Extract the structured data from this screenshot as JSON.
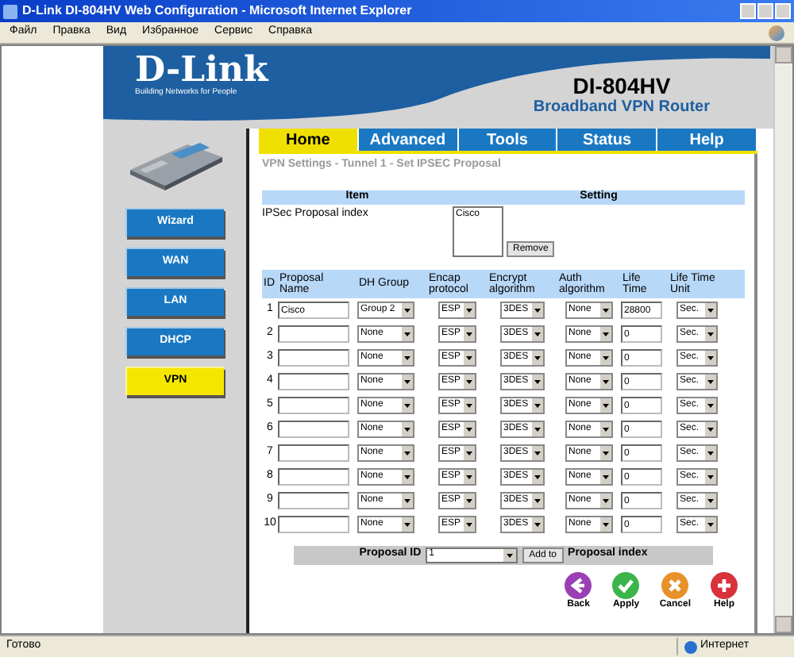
{
  "window": {
    "title": "D-Link DI-804HV Web Configuration - Microsoft Internet Explorer"
  },
  "menu": [
    "Файл",
    "Правка",
    "Вид",
    "Избранное",
    "Сервис",
    "Справка"
  ],
  "header": {
    "logo": "D-Link",
    "tagline": "Building Networks for People",
    "model": "DI-804HV",
    "product": "Broadband VPN Router"
  },
  "tabs": [
    {
      "label": "Home",
      "selected": true
    },
    {
      "label": "Advanced",
      "selected": false
    },
    {
      "label": "Tools",
      "selected": false
    },
    {
      "label": "Status",
      "selected": false
    },
    {
      "label": "Help",
      "selected": false
    }
  ],
  "sidebar": {
    "items": [
      {
        "label": "Wizard",
        "selected": false
      },
      {
        "label": "WAN",
        "selected": false
      },
      {
        "label": "LAN",
        "selected": false
      },
      {
        "label": "DHCP",
        "selected": false
      },
      {
        "label": "VPN",
        "selected": true
      }
    ]
  },
  "section_title": "VPN Settings - Tunnel 1 - Set IPSEC Proposal",
  "index_table": {
    "columns": [
      "Item",
      "Setting"
    ],
    "label": "IPSec Proposal index",
    "entries": [
      "Cisco"
    ],
    "button": "Remove"
  },
  "proposals": {
    "columns": [
      "ID",
      "Proposal Name",
      "DH Group",
      "Encap protocol",
      "Encrypt algorithm",
      "Auth algorithm",
      "Life Time",
      "Life Time Unit"
    ],
    "rows": [
      {
        "id": "1",
        "name": "Cisco",
        "dh": "Group 2",
        "encap": "ESP",
        "encrypt": "3DES",
        "auth": "None",
        "life": "28800",
        "unit": "Sec."
      },
      {
        "id": "2",
        "name": "",
        "dh": "None",
        "encap": "ESP",
        "encrypt": "3DES",
        "auth": "None",
        "life": "0",
        "unit": "Sec."
      },
      {
        "id": "3",
        "name": "",
        "dh": "None",
        "encap": "ESP",
        "encrypt": "3DES",
        "auth": "None",
        "life": "0",
        "unit": "Sec."
      },
      {
        "id": "4",
        "name": "",
        "dh": "None",
        "encap": "ESP",
        "encrypt": "3DES",
        "auth": "None",
        "life": "0",
        "unit": "Sec."
      },
      {
        "id": "5",
        "name": "",
        "dh": "None",
        "encap": "ESP",
        "encrypt": "3DES",
        "auth": "None",
        "life": "0",
        "unit": "Sec."
      },
      {
        "id": "6",
        "name": "",
        "dh": "None",
        "encap": "ESP",
        "encrypt": "3DES",
        "auth": "None",
        "life": "0",
        "unit": "Sec."
      },
      {
        "id": "7",
        "name": "",
        "dh": "None",
        "encap": "ESP",
        "encrypt": "3DES",
        "auth": "None",
        "life": "0",
        "unit": "Sec."
      },
      {
        "id": "8",
        "name": "",
        "dh": "None",
        "encap": "ESP",
        "encrypt": "3DES",
        "auth": "None",
        "life": "0",
        "unit": "Sec."
      },
      {
        "id": "9",
        "name": "",
        "dh": "None",
        "encap": "ESP",
        "encrypt": "3DES",
        "auth": "None",
        "life": "0",
        "unit": "Sec."
      },
      {
        "id": "10",
        "name": "",
        "dh": "None",
        "encap": "ESP",
        "encrypt": "3DES",
        "auth": "None",
        "life": "0",
        "unit": "Sec."
      }
    ]
  },
  "add_bar": {
    "label": "Proposal ID",
    "value": "1",
    "button": "Add to",
    "suffix": "Proposal index"
  },
  "actions": [
    {
      "kind": "back",
      "label": "Back"
    },
    {
      "kind": "apply",
      "label": "Apply"
    },
    {
      "kind": "cancel",
      "label": "Cancel"
    },
    {
      "kind": "help",
      "label": "Help"
    }
  ],
  "status_bar": {
    "text": "Готово",
    "zone": "Интернет"
  }
}
